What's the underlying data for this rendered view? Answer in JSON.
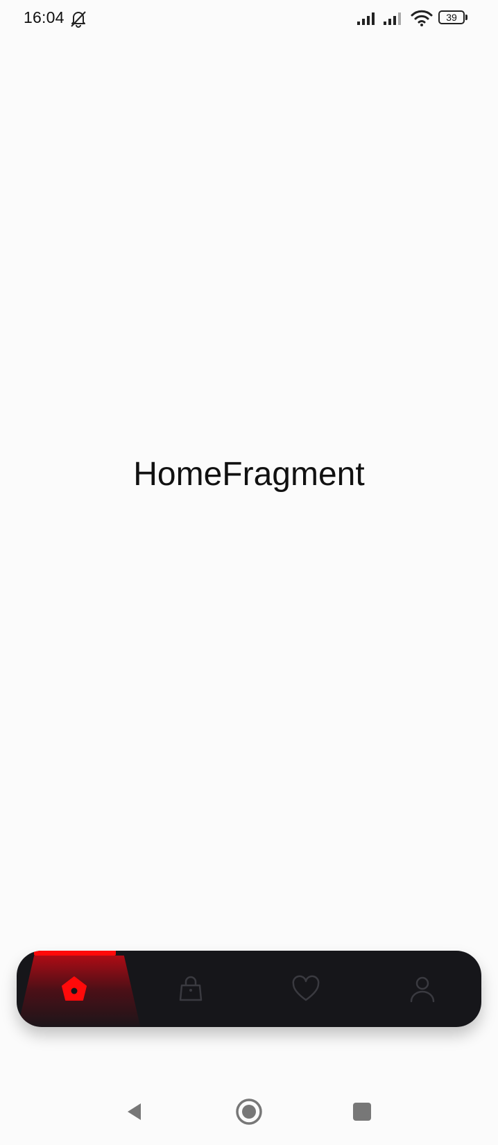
{
  "status_bar": {
    "time": "16:04",
    "battery_level": "39",
    "icons": [
      "bell-off-icon",
      "signal-icon",
      "signal-icon",
      "wifi-icon",
      "battery-icon"
    ]
  },
  "main": {
    "fragment_title": "HomeFragment"
  },
  "bottom_nav": {
    "items": [
      {
        "icon": "home-icon",
        "selected": true
      },
      {
        "icon": "shopping-bag-icon",
        "selected": false
      },
      {
        "icon": "heart-icon",
        "selected": false
      },
      {
        "icon": "user-icon",
        "selected": false
      }
    ],
    "colors": {
      "background": "#16161a",
      "active": "#ff0a0a",
      "inactive": "#3a3a40"
    }
  },
  "system_nav": {
    "buttons": [
      "back-icon",
      "home-circle-icon",
      "recents-icon"
    ]
  }
}
